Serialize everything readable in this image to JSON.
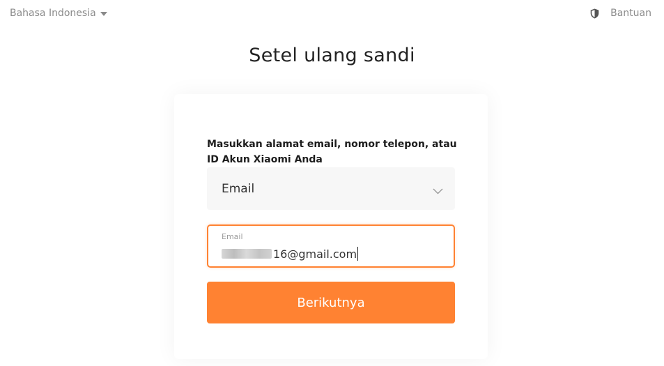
{
  "header": {
    "language_label": "Bahasa Indonesia",
    "help_label": "Bantuan"
  },
  "page": {
    "title": "Setel ulang sandi"
  },
  "form": {
    "instruction": "Masukkan alamat email, nomor telepon, atau ID Akun Xiaomi Anda",
    "type_select": {
      "selected": "Email"
    },
    "email_field": {
      "label": "Email",
      "value_visible": "16@gmail.com"
    },
    "submit_label": "Berikutnya"
  },
  "colors": {
    "accent": "#ff8232",
    "muted_text": "#8a8a8a",
    "select_bg": "#f7f7f7"
  },
  "icons": {
    "language": "caret-down-icon",
    "help": "shield-icon",
    "select": "chevron-down-icon"
  }
}
